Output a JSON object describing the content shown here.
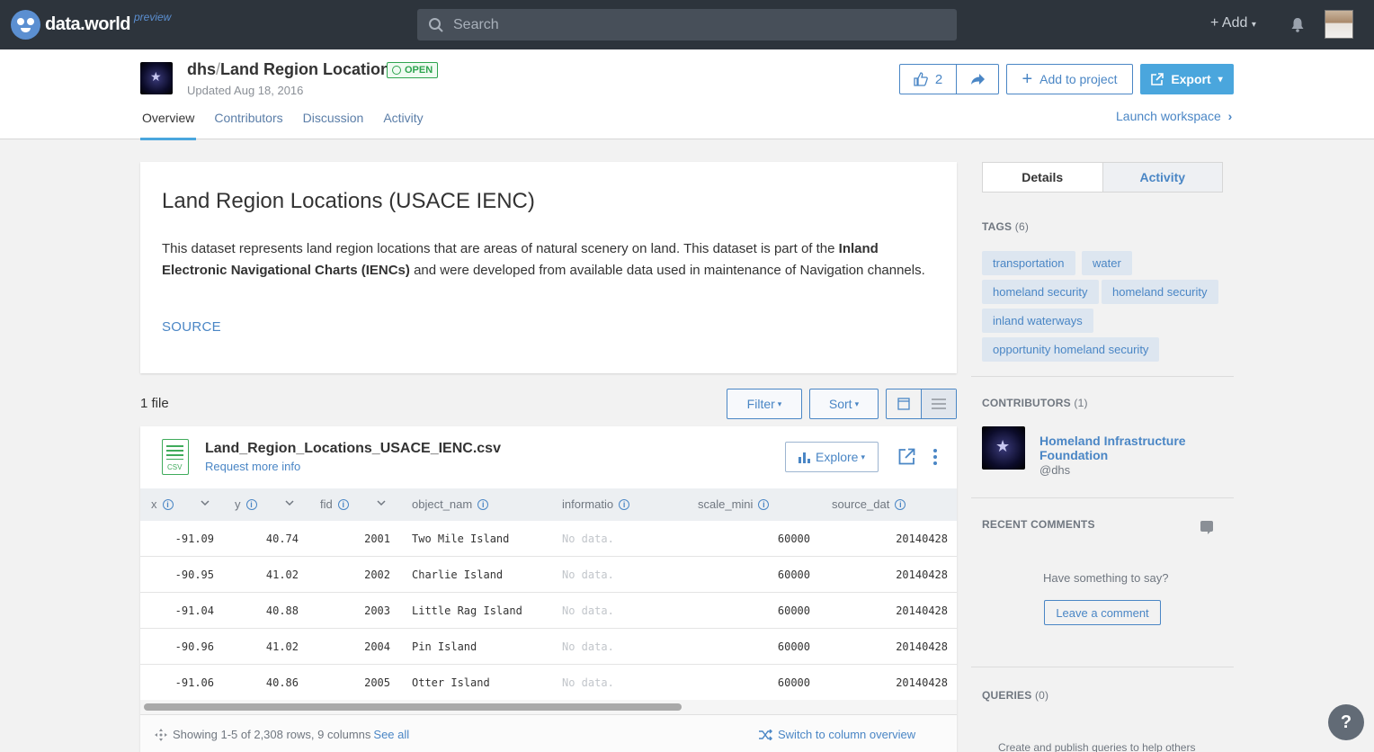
{
  "nav": {
    "brand": "data.world",
    "brand_tag": "preview",
    "search_placeholder": "Search",
    "add_label": "+ Add"
  },
  "dataset": {
    "owner": "dhs",
    "separator": "/",
    "name": "Land Region Locations",
    "badge": "OPEN",
    "updated": "Updated Aug 18, 2016",
    "likes": "2",
    "add_to_project": "Add to project",
    "export": "Export",
    "launch_workspace": "Launch workspace",
    "tabs": [
      "Overview",
      "Contributors",
      "Discussion",
      "Activity"
    ]
  },
  "description": {
    "title": "Land Region Locations (USACE IENC)",
    "text_before": "This dataset represents land region locations that are areas of natural scenery on land. This dataset is part of the ",
    "text_bold": "Inland Electronic Navigational Charts (IENCs)",
    "text_after": " and were developed from available data used in maintenance of Navigation channels.",
    "source": "SOURCE"
  },
  "files": {
    "count": "1 file",
    "filter": "Filter",
    "sort": "Sort",
    "file_name": "Land_Region_Locations_USACE_IENC.csv",
    "file_icon_label": "CSV",
    "request_info": "Request more info",
    "explore": "Explore",
    "columns": [
      "x",
      "y",
      "fid",
      "object_nam",
      "informatio",
      "scale_mini",
      "source_dat"
    ],
    "rows": [
      {
        "x": "-91.09",
        "y": "40.74",
        "fid": "2001",
        "object_nam": "Two Mile Island",
        "informatio": "No data.",
        "scale_mini": "60000",
        "source_dat": "20140428"
      },
      {
        "x": "-90.95",
        "y": "41.02",
        "fid": "2002",
        "object_nam": "Charlie Island",
        "informatio": "No data.",
        "scale_mini": "60000",
        "source_dat": "20140428"
      },
      {
        "x": "-91.04",
        "y": "40.88",
        "fid": "2003",
        "object_nam": "Little Rag Island",
        "informatio": "No data.",
        "scale_mini": "60000",
        "source_dat": "20140428"
      },
      {
        "x": "-90.96",
        "y": "41.02",
        "fid": "2004",
        "object_nam": "Pin Island",
        "informatio": "No data.",
        "scale_mini": "60000",
        "source_dat": "20140428"
      },
      {
        "x": "-91.06",
        "y": "40.86",
        "fid": "2005",
        "object_nam": "Otter Island",
        "informatio": "No data.",
        "scale_mini": "60000",
        "source_dat": "20140428"
      }
    ],
    "showing": "Showing 1-5 of 2,308 rows, 9 columns",
    "see_all": "See all",
    "switch_overview": "Switch to column overview"
  },
  "sidebar": {
    "tab_details": "Details",
    "tab_activity": "Activity",
    "tags_label": "TAGS",
    "tags_count": "(6)",
    "tags": [
      "transportation",
      "water",
      "homeland security",
      "homeland security",
      "inland waterways",
      "opportunity homeland security"
    ],
    "contributors_label": "CONTRIBUTORS",
    "contributors_count": "(1)",
    "contributor_name": "Homeland Infrastructure Foundation",
    "contributor_handle": "@dhs",
    "recent_comments_label": "RECENT COMMENTS",
    "have_something": "Have something to say?",
    "leave_comment": "Leave a comment",
    "queries_label": "QUERIES",
    "queries_count": "(0)",
    "queries_hint": "Create and publish queries to help others"
  },
  "help": "?",
  "colors": {
    "nav_bg": "#2d343c",
    "accent": "#4a86c5",
    "export_bg": "#4aa6dd",
    "open_green": "#2ea44f"
  }
}
